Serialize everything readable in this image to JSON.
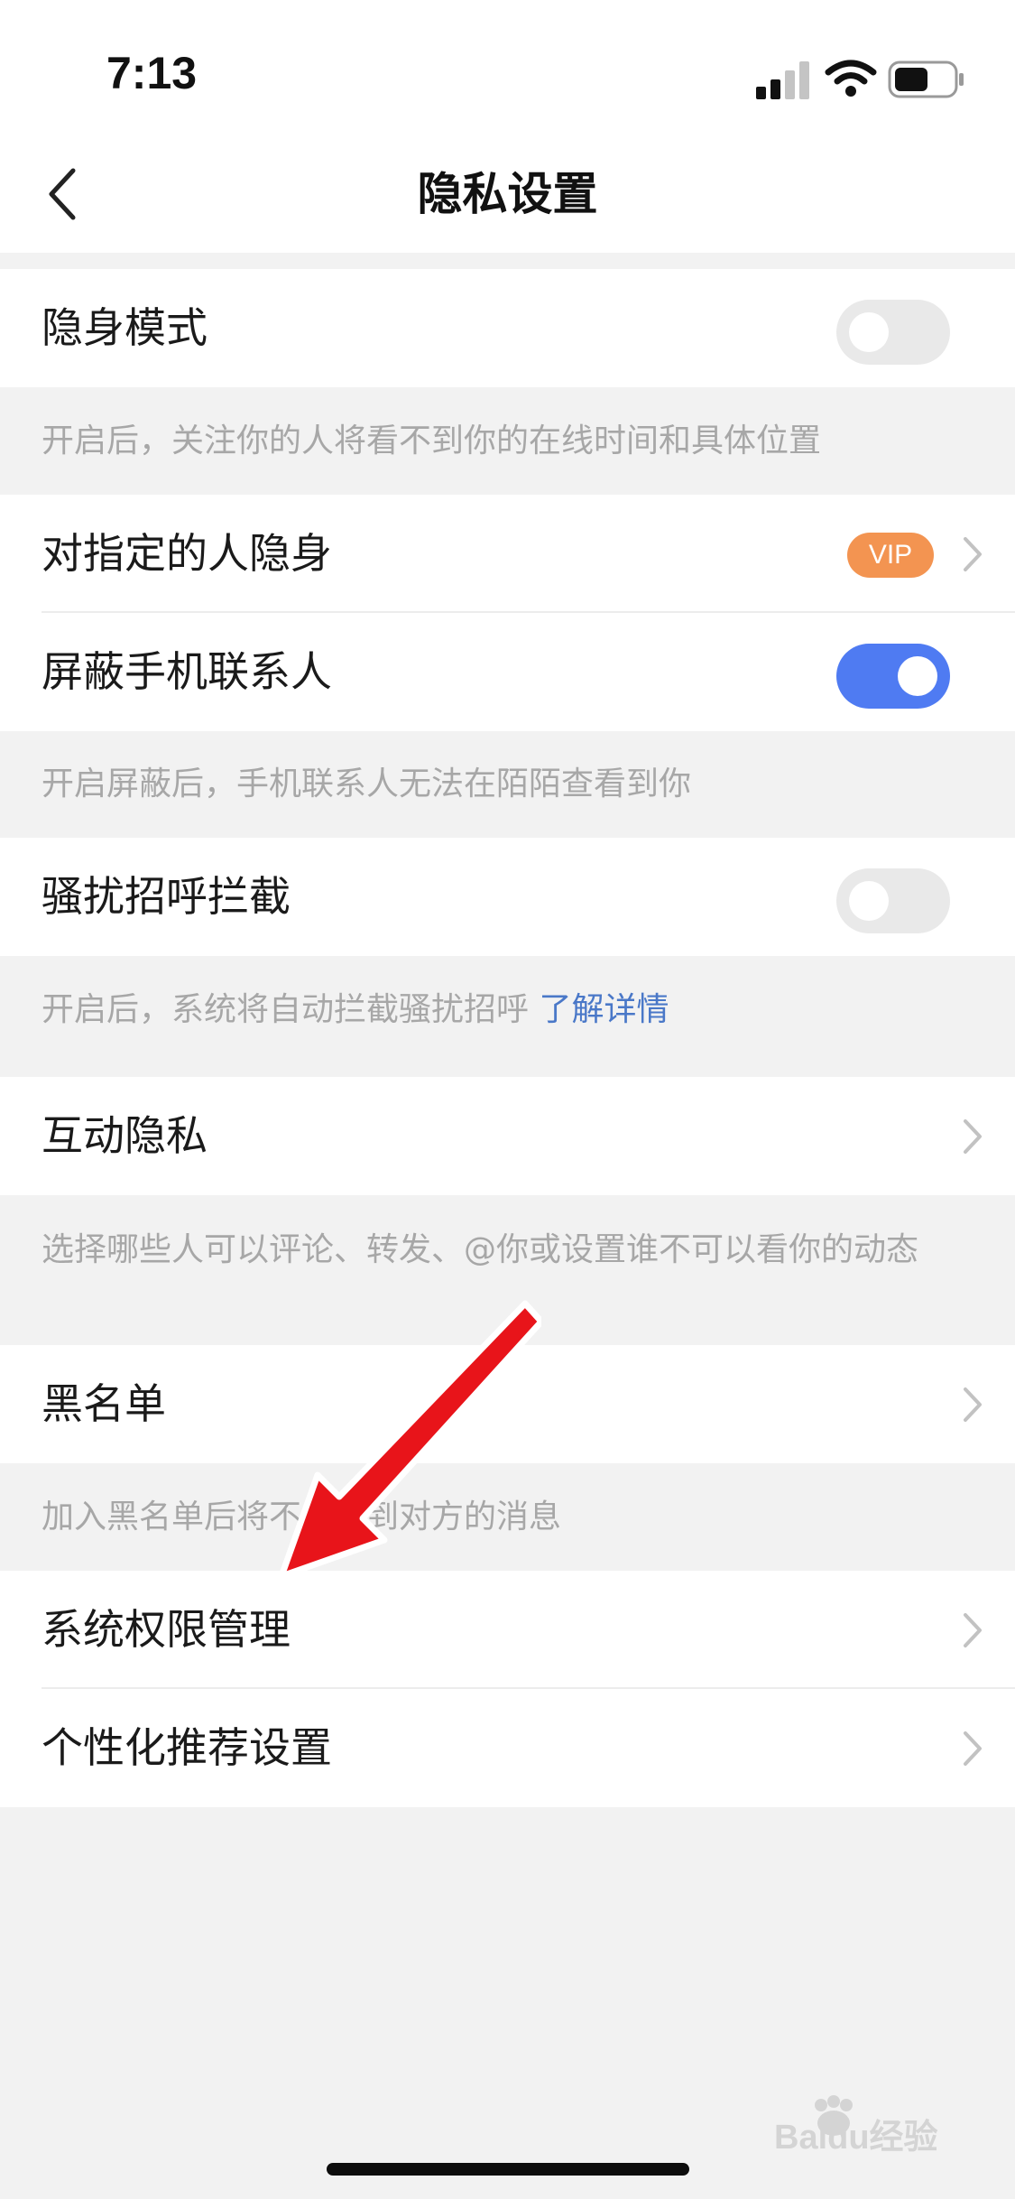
{
  "status_bar": {
    "time": "7:13",
    "icons": [
      "signal-icon",
      "wifi-icon",
      "battery-icon"
    ]
  },
  "nav": {
    "title": "隐私设置",
    "back_icon": "back-chevron-icon"
  },
  "settings": {
    "invisible_mode": {
      "label": "隐身模式",
      "toggle_on": false
    },
    "invisible_mode_note": "开启后，关注你的人将看不到你的在线时间和具体位置",
    "invisible_to_specific": {
      "label": "对指定的人隐身",
      "badge": "VIP"
    },
    "block_contacts": {
      "label": "屏蔽手机联系人",
      "toggle_on": true
    },
    "block_contacts_note": "开启屏蔽后，手机联系人无法在陌陌查看到你",
    "harassment_block": {
      "label": "骚扰招呼拦截",
      "toggle_on": false
    },
    "harassment_note": "开启后，系统将自动拦截骚扰招呼",
    "harassment_link": "了解详情",
    "interaction_privacy": {
      "label": "互动隐私"
    },
    "interaction_note": "选择哪些人可以评论、转发、@你或设置谁不可以看你的动态",
    "blacklist": {
      "label": "黑名单"
    },
    "blacklist_note": "加入黑名单后将不会收到对方的消息",
    "system_permissions": {
      "label": "系统权限管理"
    },
    "personalized_recommendation": {
      "label": "个性化推荐设置"
    }
  },
  "colors": {
    "toggle_on": "#4f7bf2",
    "toggle_off": "#e9e9e9",
    "vip_badge": "#f39451",
    "link": "#4a78c8",
    "note_text": "#a7a7a7",
    "annotation_arrow": "#e8141a"
  },
  "watermark": "Baidu经验"
}
